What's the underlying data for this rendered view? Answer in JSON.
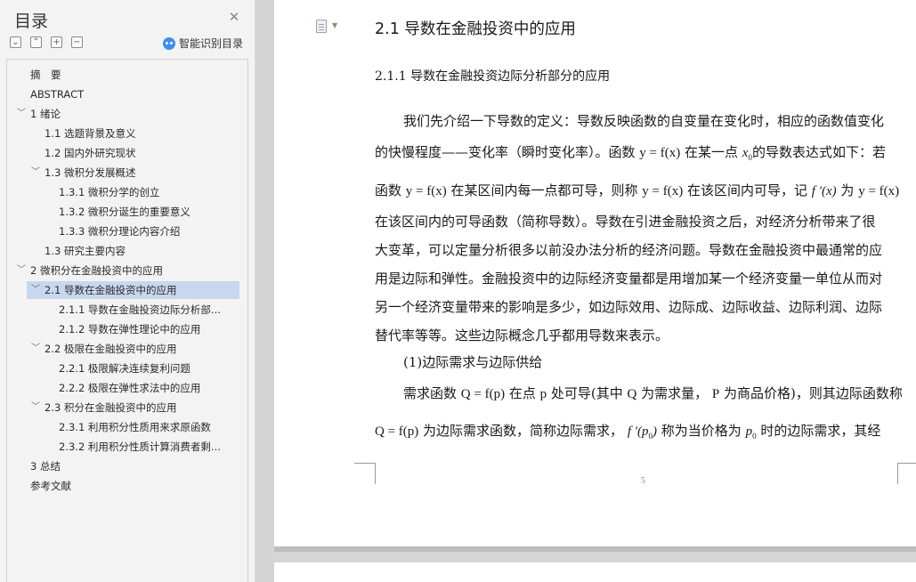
{
  "sidebar": {
    "title": "目录",
    "close_icon": "close-icon",
    "tools": [
      "expand-all-icon",
      "collapse-all-icon",
      "add-heading-icon",
      "remove-heading-icon"
    ],
    "smart_label": "智能识别目录",
    "toc": [
      {
        "label": "摘　要"
      },
      {
        "label": "ABSTRACT"
      },
      {
        "label": "1 绪论"
      },
      {
        "label": "1.1 选题背景及意义"
      },
      {
        "label": "1.2 国内外研究现状"
      },
      {
        "label": "1.3 微积分发展概述"
      },
      {
        "label": "1.3.1 微积分学的创立"
      },
      {
        "label": "1.3.2 微积分诞生的重要意义"
      },
      {
        "label": "1.3.3 微积分理论内容介绍"
      },
      {
        "label": "1.3 研究主要内容"
      },
      {
        "label": "2 微积分在金融投资中的应用"
      },
      {
        "label": "2.1 导数在金融投资中的应用"
      },
      {
        "label": "2.1.1 导数在金融投资边际分析部..."
      },
      {
        "label": "2.1.2 导数在弹性理论中的应用"
      },
      {
        "label": "2.2 极限在金融投资中的应用"
      },
      {
        "label": "2.2.1 极限解决连续复利问题"
      },
      {
        "label": "2.2.2 极限在弹性求法中的应用"
      },
      {
        "label": "2.3 积分在金融投资中的应用"
      },
      {
        "label": "2.3.1 利用积分性质用来求原函数"
      },
      {
        "label": "2.3.2 利用积分性质计算消费者剩..."
      },
      {
        "label": "3 总结"
      },
      {
        "label": "参考文献"
      }
    ]
  },
  "document": {
    "heading2": "2.1 导数在金融投资中的应用",
    "heading3": "2.1.1 导数在金融投资边际分析部分的应用",
    "lines": [
      {
        "t": "我们先介绍一下导数的定义：导数反映函数的自变量在变化时，相应的函数值变化"
      },
      {
        "a": "的快慢程度——变化率（瞬时变化率）。函数 ",
        "m1": "y = f(x)",
        "b": " 在某一点 ",
        "m2": "x",
        "sub": "0",
        "c": "的导数表达式如下：若"
      },
      {
        "a": "函数 ",
        "m1": "y = f(x)",
        "b": " 在某区间内每一点都可导，则称 ",
        "m2": "y = f(x)",
        "c": " 在该区间内可导，记 ",
        "m3": "f ′(x)",
        "d": " 为 ",
        "m4": "y = f(x)"
      },
      {
        "t": "在该区间内的可导函数（简称导数）。导数在引进金融投资之后，对经济分析带来了很"
      },
      {
        "t": "大变革，可以定量分析很多以前没办法分析的经济问题。导数在金融投资中最通常的应"
      },
      {
        "t": "用是边际和弹性。金融投资中的边际经济变量都是用增加某一个经济变量一单位从而对"
      },
      {
        "t": "另一个经济变量带来的影响是多少，如边际效用、边际成、边际收益、边际利润、边际"
      },
      {
        "t": "替代率等等。这些边际概念几乎都用导数来表示。"
      },
      {
        "t": "(1)边际需求与边际供给"
      },
      {
        "a": "需求函数 ",
        "m1": "Q = f(p)",
        "b": " 在点 ",
        "m2": "p",
        "c": " 处可导(其中 ",
        "m3": "Q",
        "d": " 为需求量， ",
        "m4": "P",
        "e": " 为商品价格)，则其边际函数称"
      },
      {
        "a": "",
        "m1": "Q = f(p)",
        "b": " 为边际需求函数，简称边际需求， ",
        "m2": "f ′(p",
        "sub": "0",
        "m3": ")",
        "c": " 称为当价格为 ",
        "m4": "p",
        "sub2": "0",
        "d": " 时的边际需求，其经"
      }
    ],
    "page_number": "5"
  }
}
